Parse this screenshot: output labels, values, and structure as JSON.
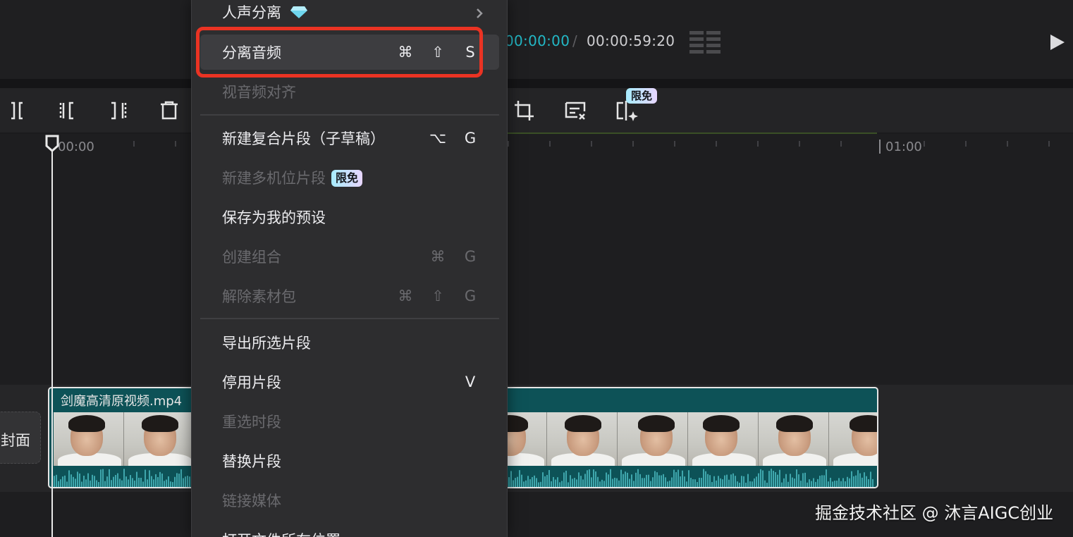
{
  "player": {
    "time_current": "00:00:00",
    "time_separator": "/",
    "time_total": "00:00:59:20",
    "quality_icon": "grid-bars-icon",
    "play_icon": "play-icon"
  },
  "toolbar": {
    "icons": [
      "split-icon",
      "trim-left-icon",
      "trim-right-icon",
      "delete-icon",
      "crop-icon",
      "remove-bg-icon",
      "ai-cutout-icon"
    ],
    "badge": "限免"
  },
  "timeline": {
    "ruler_start": "00:00",
    "ruler_minute": "01:00",
    "cover_label": "封面",
    "clip_title": "剑魔高清原视频.mp4",
    "clip_color": "#0d5257"
  },
  "menu": {
    "voice_separate": {
      "label": "人声分离",
      "icon": "diamond-icon",
      "arrow": "chevron-right-icon"
    },
    "separate_audio": {
      "label": "分离音频",
      "shortcut": [
        "⌘",
        "⇧",
        "S"
      ]
    },
    "align_audio": {
      "label": "视音频对齐"
    },
    "new_compound": {
      "label": "新建复合片段（子草稿）",
      "shortcut": [
        "⌥",
        "G"
      ]
    },
    "new_multicam": {
      "label": "新建多机位片段",
      "badge": "限免"
    },
    "save_preset": {
      "label": "保存为我的预设"
    },
    "create_group": {
      "label": "创建组合",
      "shortcut": [
        "⌘",
        "G"
      ]
    },
    "unpack": {
      "label": "解除素材包",
      "shortcut": [
        "⌘",
        "⇧",
        "G"
      ]
    },
    "export_selected": {
      "label": "导出所选片段"
    },
    "disable_clip": {
      "label": "停用片段",
      "shortcut": [
        "V"
      ]
    },
    "reselect_range": {
      "label": "重选时段"
    },
    "replace_clip": {
      "label": "替换片段"
    },
    "link_media": {
      "label": "链接媒体"
    },
    "open_location": {
      "label": "打开文件所在位置"
    }
  },
  "watermark": "掘金技术社区 @ 沐言AIGC创业",
  "colors": {
    "accent_time": "#23b8c6",
    "highlight_box": "#ea3323",
    "clip_bg": "#0d5257"
  }
}
